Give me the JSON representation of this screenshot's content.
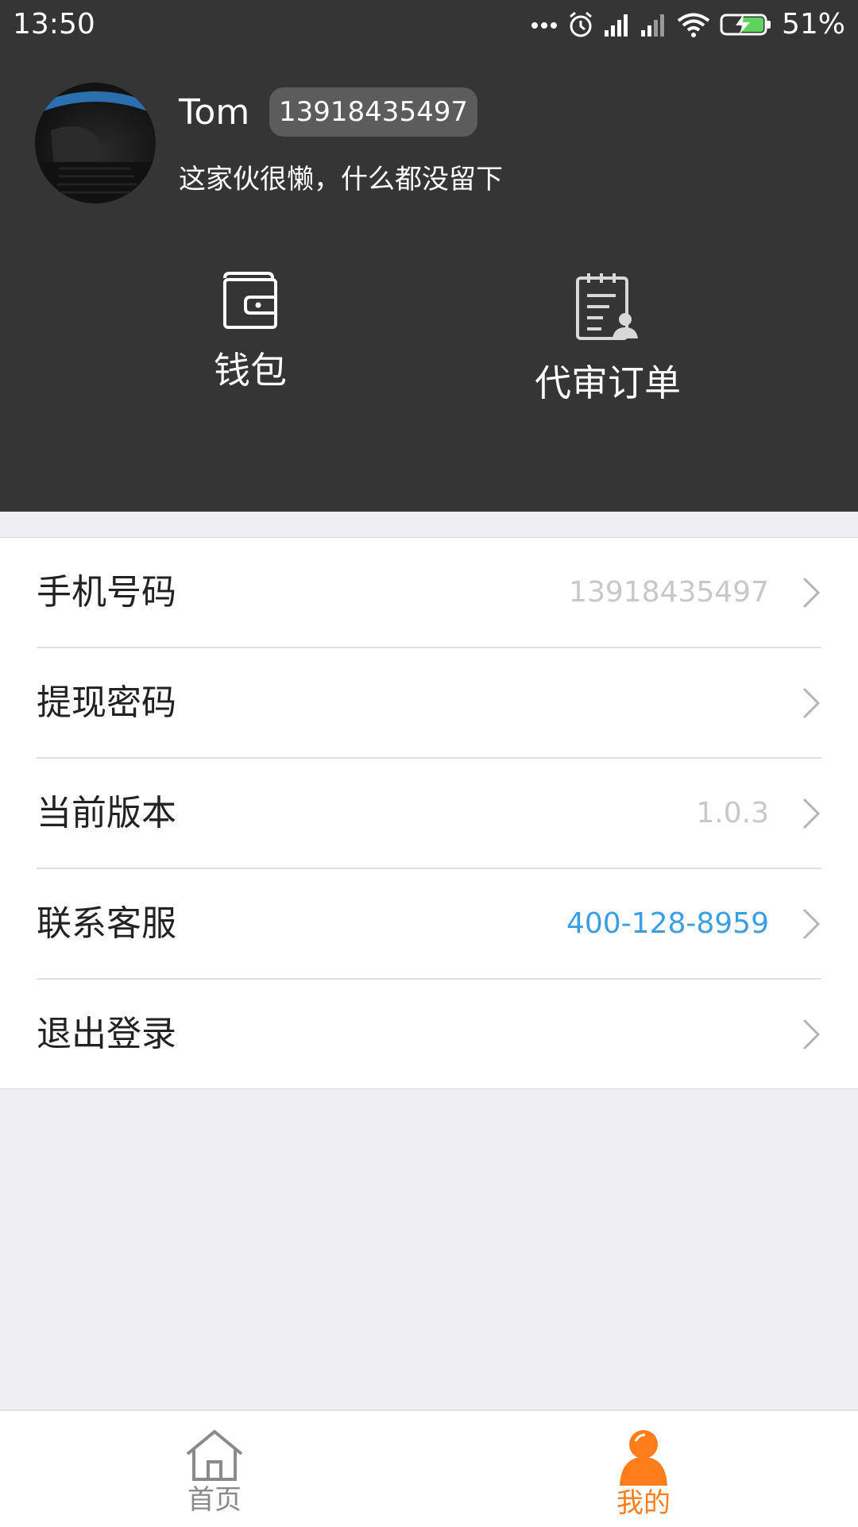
{
  "status_bar": {
    "time": "13:50",
    "battery": "51%",
    "icons": [
      "more-dots-icon",
      "alarm-icon",
      "signal-icon",
      "signal-icon",
      "wifi-icon",
      "battery-charging-icon"
    ]
  },
  "profile": {
    "name": "Tom",
    "phone_badge": "13918435497",
    "signature": "这家伙很懒，什么都没留下"
  },
  "quick_actions": [
    {
      "label": "钱包",
      "icon": "wallet-icon"
    },
    {
      "label": "代审订单",
      "icon": "order-review-icon"
    }
  ],
  "menu": [
    {
      "label": "手机号码",
      "value": "13918435497"
    },
    {
      "label": "提现密码",
      "value": ""
    },
    {
      "label": "当前版本",
      "value": "1.0.3"
    },
    {
      "label": "联系客服",
      "value": "400-128-8959"
    },
    {
      "label": "退出登录",
      "value": ""
    }
  ],
  "tabbar": {
    "home": "首页",
    "mine": "我的"
  },
  "colors": {
    "header_bg": "#353535",
    "accent": "#ff7d1a",
    "link": "#3a9ee6",
    "page_bg": "#efeff3"
  }
}
